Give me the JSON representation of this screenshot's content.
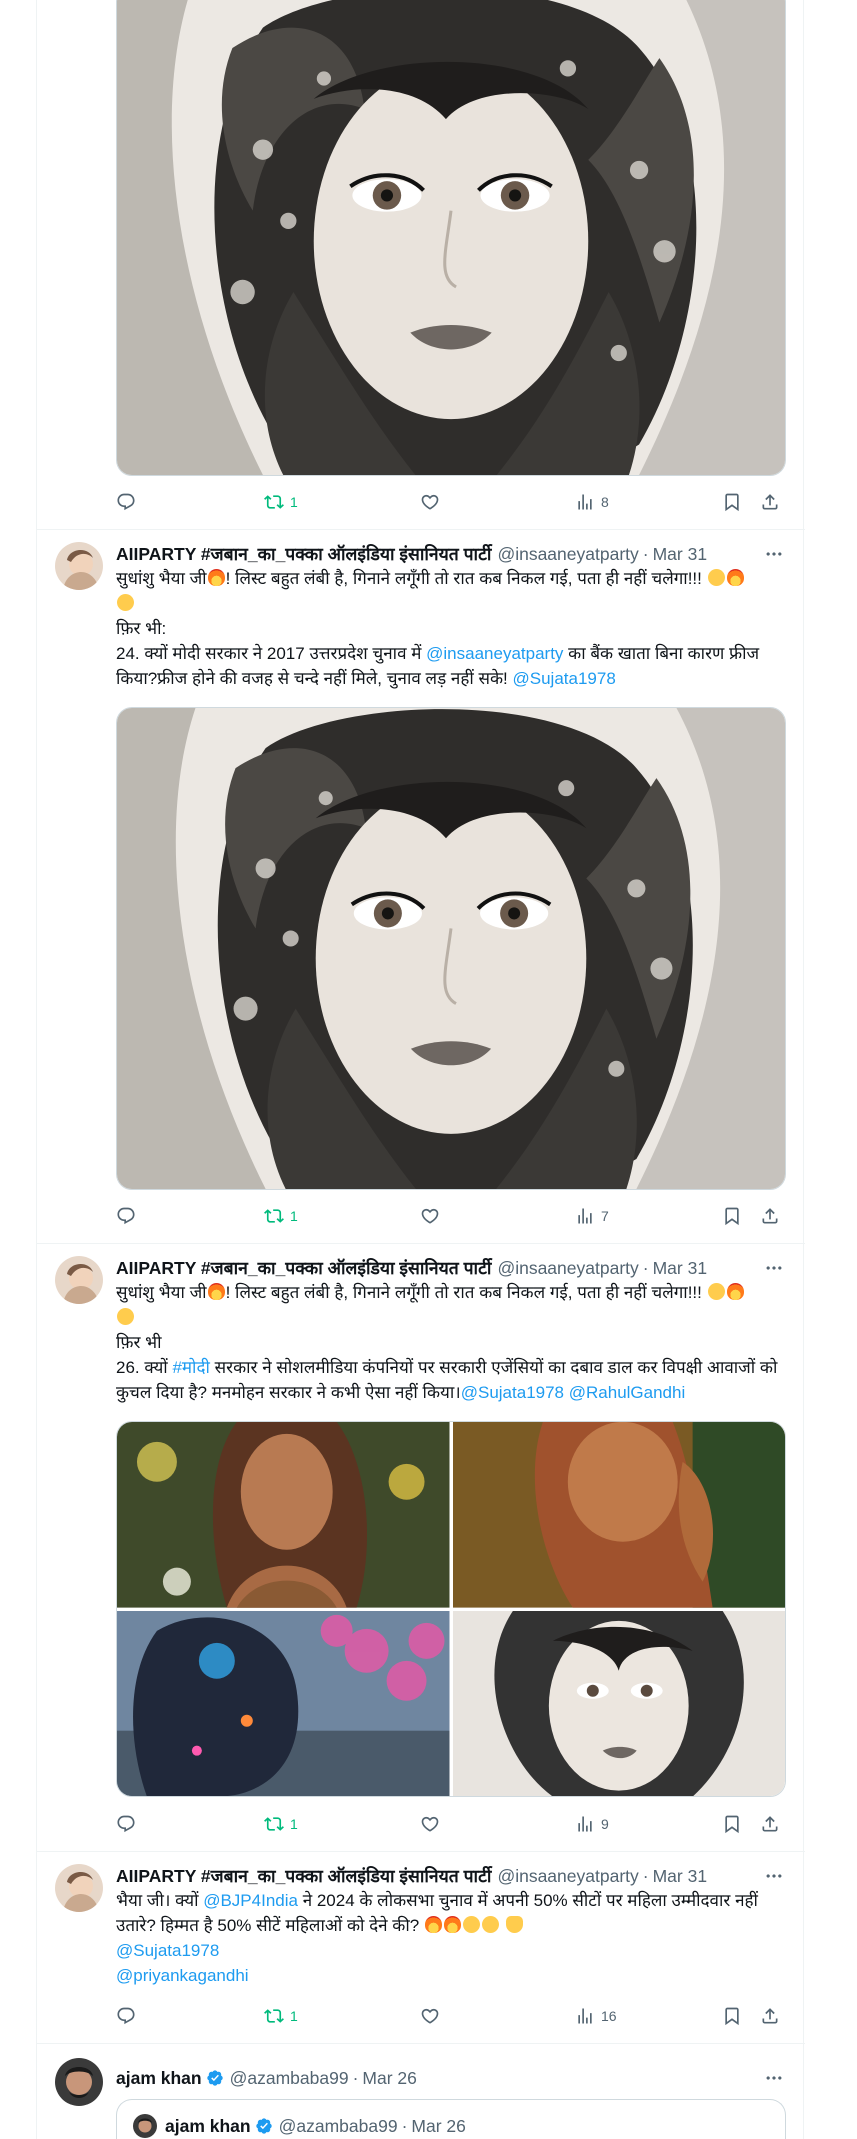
{
  "colors": {
    "accent": "#1d9bf0",
    "retweet_green": "#00ba7c",
    "secondary_text": "#536471",
    "border": "#cfd9de"
  },
  "tweets": [
    {
      "stats": {
        "replies": "",
        "retweets": "1",
        "likes": "",
        "views": "8"
      }
    },
    {
      "author_name": "AIIPARTY #जबान_का_पक्का ऑलइंडिया इंसानियत पार्टी",
      "author_handle": "@insaaneyatparty",
      "separator": "·",
      "date": "Mar 31",
      "text": {
        "part1": "सुधांशु भैया जी",
        "part2": "! लिस्ट बहुत लंबी है, गिनाने लगूँगी तो रात कब निकल गई, पता ही नहीं चलेगा!!! ",
        "line2": "फ़िर भी:",
        "line3_pre": "24. क्यों मोदी सरकार ने 2017 उत्तरप्रदेश चुनाव में ",
        "mention1": "@insaaneyatparty",
        "line3_post": " का बैंक खाता बिना कारण फ्रीज किया?फ्रीज होने की वजह से चन्दे नहीं मिले, चुनाव लड़ नहीं सके! ",
        "mention2": "@Sujata1978"
      },
      "stats": {
        "replies": "",
        "retweets": "1",
        "likes": "",
        "views": "7"
      }
    },
    {
      "author_name": "AIIPARTY #जबान_का_पक्का ऑलइंडिया इंसानियत पार्टी",
      "author_handle": "@insaaneyatparty",
      "separator": "·",
      "date": "Mar 31",
      "text": {
        "part1": "सुधांशु भैया जी",
        "part2": "! लिस्ट बहुत लंबी है, गिनाने लगूँगी तो रात कब निकल गई, पता ही नहीं चलेगा!!! ",
        "line2": "फ़िर भी",
        "line3_pre": "26. क्यों ",
        "hashtag": "#मोदी",
        "line3_post": " सरकार ने सोशलमीडिया कंपनियों पर सरकारी एजेंसियों का दबाव डाल कर विपक्षी आवाजों को कुचल दिया है? मनमोहन सरकार ने कभी ऐसा नहीं किया।",
        "mention1": "@Sujata1978",
        "mention2": "@RahulGandhi"
      },
      "stats": {
        "replies": "",
        "retweets": "1",
        "likes": "",
        "views": "9"
      }
    },
    {
      "author_name": "AIIPARTY #जबान_का_पक्का ऑलइंडिया इंसानियत पार्टी",
      "author_handle": "@insaaneyatparty",
      "separator": "·",
      "date": "Mar 31",
      "text": {
        "pre": "भैया जी। क्यों ",
        "mention1": "@BJP4India",
        "post": " ने   2024 के लोकसभा चुनाव में अपनी 50% सीटों पर महिला उम्मीदवार नहीं उतारे? हिम्मत है 50% सीटें महिलाओं को देने की? ",
        "mention2": "@Sujata1978",
        "mention3": "@priyankagandhi"
      },
      "stats": {
        "replies": "",
        "retweets": "1",
        "likes": "",
        "views": "16"
      }
    },
    {
      "author_name": "ajam khan",
      "author_handle": "@azambaba99",
      "separator": "·",
      "date": "Mar 26",
      "quote": {
        "author_name": "ajam khan",
        "author_handle": "@azambaba99",
        "separator": "·",
        "date": "Mar 26"
      }
    }
  ]
}
